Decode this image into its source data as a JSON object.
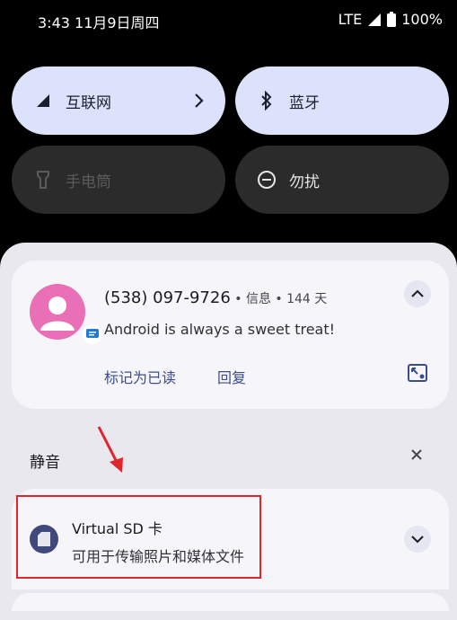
{
  "status_bar": {
    "time": "3:43 11月9日周四",
    "network": "LTE",
    "battery": "100%"
  },
  "quick_settings": {
    "internet": "互联网",
    "bluetooth": "蓝牙",
    "flashlight": "手电筒",
    "dnd": "勿扰"
  },
  "notification_sms": {
    "title": "(538) 097-9726",
    "meta": " • 信息 • 144 天",
    "message": "Android is always a sweet treat!",
    "action_mark_read": "标记为已读",
    "action_reply": "回复"
  },
  "silent_section": {
    "label": "静音"
  },
  "notification_sd": {
    "title": "Virtual SD 卡",
    "subtitle": "可用于传输照片和媒体文件"
  },
  "colors": {
    "accent": "#3c4d8c",
    "highlight": "#e0262b",
    "avatar": "#e96fb6"
  }
}
